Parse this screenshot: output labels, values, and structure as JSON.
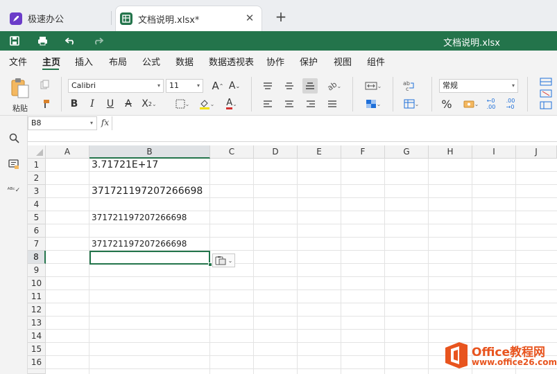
{
  "tabs": [
    {
      "label": "极速办公",
      "icon": "rocket-icon",
      "active": false
    },
    {
      "label": "文档说明.xlsx*",
      "icon": "spreadsheet-icon",
      "active": true
    }
  ],
  "quickbar": {
    "title": "文档说明.xlsx"
  },
  "menu": [
    "文件",
    "主页",
    "插入",
    "布局",
    "公式",
    "数据",
    "数据透视表",
    "协作",
    "保护",
    "视图",
    "组件"
  ],
  "active_menu": "主页",
  "ribbon": {
    "paste_label": "粘贴",
    "font_name": "Calibri",
    "font_size": "11",
    "number_format": "常规"
  },
  "formula_bar": {
    "name_box": "B8",
    "fx_label": "fx",
    "formula": ""
  },
  "grid": {
    "columns": [
      "A",
      "B",
      "C",
      "D",
      "E",
      "F",
      "G",
      "H",
      "I",
      "J"
    ],
    "rows": [
      "1",
      "2",
      "3",
      "4",
      "5",
      "6",
      "7",
      "8",
      "9",
      "10",
      "11",
      "12",
      "13",
      "14",
      "15",
      "16"
    ],
    "cells": [
      {
        "ref": "B1",
        "value": "3.71721E+17"
      },
      {
        "ref": "B3",
        "value": "371721197207266698"
      },
      {
        "ref": "B5",
        "value": "371721197207266698"
      },
      {
        "ref": "B7",
        "value": "371721197207266698"
      }
    ],
    "selected": "B8"
  },
  "watermark": {
    "brand": "Office教程网",
    "url": "www.office26.com"
  },
  "colors": {
    "accent": "#23744b",
    "watermark_orange": "#e8541e"
  }
}
